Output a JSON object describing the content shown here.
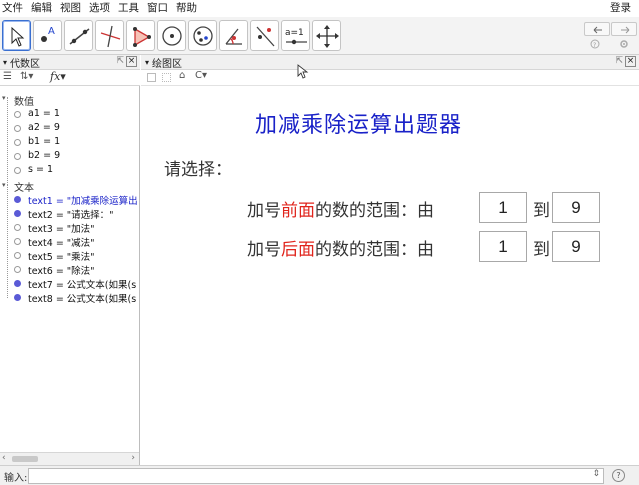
{
  "menu": {
    "items": [
      "文件",
      "编辑",
      "视图",
      "选项",
      "工具",
      "窗口",
      "帮助"
    ],
    "login": "登录"
  },
  "toolbar": {
    "tools": [
      "move-tool",
      "point-tool",
      "line-tool",
      "perpendicular-line-tool",
      "polygon-tool",
      "circle-tool",
      "circle-through-points-tool",
      "angle-tool",
      "reflect-tool",
      "slider-tool",
      "move-graphics-view-tool"
    ],
    "slider_label": "a=1"
  },
  "algebra": {
    "title": "代数区",
    "groups": [
      {
        "name": "数值",
        "items": [
          {
            "text": "a1 = 1"
          },
          {
            "text": "a2 = 9"
          },
          {
            "text": "b1 = 1"
          },
          {
            "text": "b2 = 9"
          },
          {
            "text": "s = 1"
          }
        ]
      },
      {
        "name": "文本",
        "items": [
          {
            "text": "text1 = \"加减乘除运算出",
            "blue": true,
            "filled": true
          },
          {
            "text": "text2 = \"请选择：\"",
            "filled": true
          },
          {
            "text": "text3 = \"加法\""
          },
          {
            "text": "text4 = \"减法\""
          },
          {
            "text": "text5 = \"乘法\""
          },
          {
            "text": "text6 = \"除法\""
          },
          {
            "text": "text7 = 公式文本(如果(s",
            "filled": true
          },
          {
            "text": "text8 = 公式文本(如果(s",
            "filled": true
          }
        ]
      }
    ]
  },
  "graphics": {
    "title": "绘图区",
    "heading": "加减乘除运算出题器",
    "prompt": "请选择：",
    "row1": {
      "prefix": "加号",
      "red": "前面",
      "suffix": "的数的范围：由",
      "from": "1",
      "to_word": "到",
      "to": "9"
    },
    "row2": {
      "prefix": "加号",
      "red": "后面",
      "suffix": "的数的范围：由",
      "from": "1",
      "to_word": "到",
      "to": "9"
    }
  },
  "input": {
    "label": "输入:"
  },
  "colors": {
    "heading": "#1a22c8",
    "highlight": "#e0241c",
    "bullet": "#5a5ad6"
  }
}
